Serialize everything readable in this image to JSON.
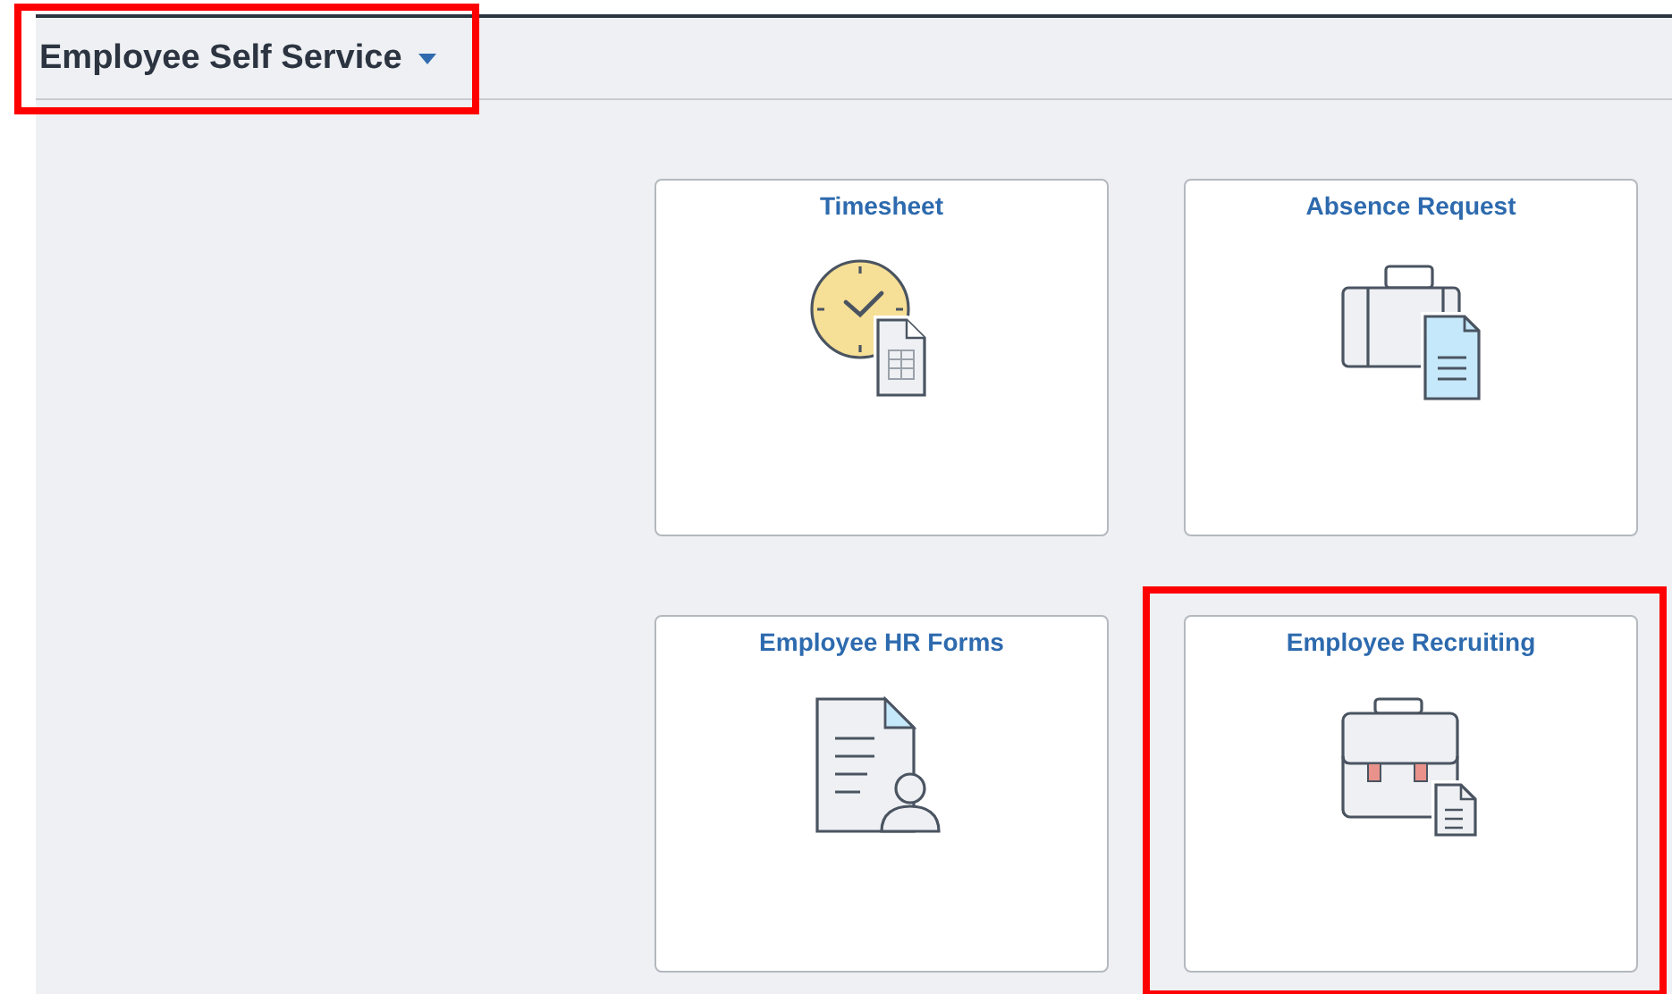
{
  "header": {
    "title": "Employee Self Service",
    "highlighted": true
  },
  "tiles": [
    {
      "title": "Timesheet",
      "kind": "clock",
      "highlighted": false
    },
    {
      "title": "Absence Request",
      "kind": "suitcase",
      "highlighted": false
    },
    {
      "title": "Employee HR Forms",
      "kind": "document",
      "highlighted": false
    },
    {
      "title": "Employee Recruiting",
      "kind": "briefcase",
      "highlighted": true
    }
  ]
}
